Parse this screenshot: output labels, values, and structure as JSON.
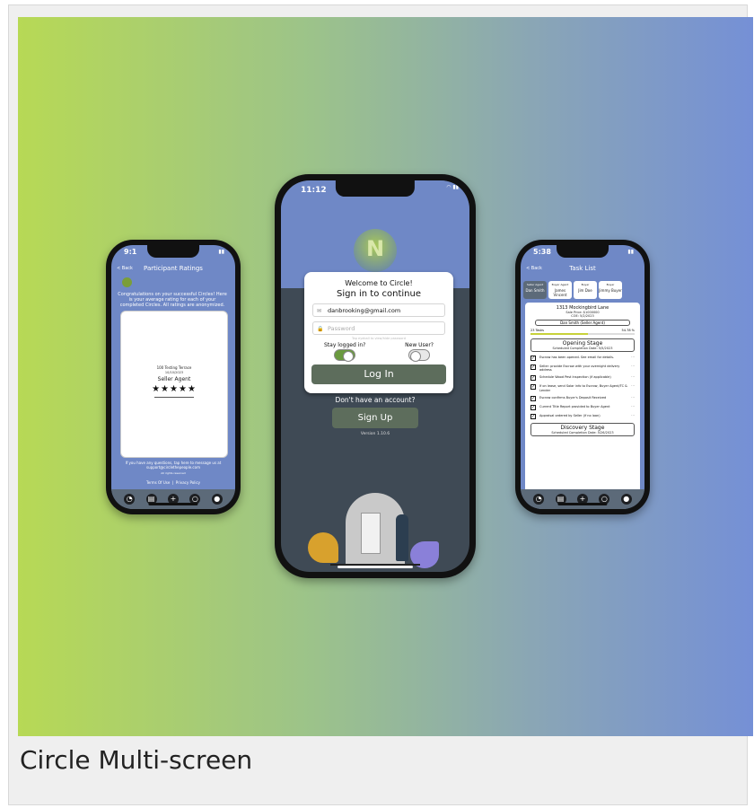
{
  "caption": "Circle Multi-screen",
  "colors": {
    "gradient_start": "#b7d955",
    "gradient_end": "#7590d6",
    "accent": "#6f88c6",
    "button": "#5d6d5c"
  },
  "left_phone": {
    "time": "9:1",
    "back": "< Back",
    "title": "Participant Ratings",
    "message": "Congratulations on your successful Circles! Here is your average rating for each of your completed Circles. All ratings are anonymized.",
    "address": "100 Testing Terrace",
    "date": "10/10/2023",
    "role": "Seller Agent",
    "stars": "★★★★★",
    "footer": "If you have any questions, tap here to message us at support@circlethepeople.com",
    "rights": "All rights reserved",
    "terms": "Terms Of Use",
    "privacy": "Privacy Policy"
  },
  "center_phone": {
    "time": "11:12",
    "welcome": "Welcome to Circle!",
    "signin": "Sign in to continue",
    "email": "danbrooking@gmail.com",
    "password_placeholder": "Password",
    "hint": "Tap eyeball to view/hide password",
    "stay_logged": "Stay logged in?",
    "new_user": "New User?",
    "login_label": "Log In",
    "no_account": "Don't have an account?",
    "signup_label": "Sign Up",
    "version": "Version 1.10.6"
  },
  "right_phone": {
    "time": "5:38",
    "back": "< Back",
    "title": "Task List",
    "agents": [
      {
        "role": "Seller Agent",
        "name": "Dan Smith"
      },
      {
        "role": "Buyer Agent",
        "name": "James Vincent"
      },
      {
        "role": "Buyer",
        "name": "Jim Doe"
      },
      {
        "role": "Buyer",
        "name": "Jimmy Buyer"
      }
    ],
    "address": "1313 Mockingbird Lane",
    "sale_price": "Sale Price: $1000000",
    "coe": "COE: 5/2/2023",
    "agent_button": "Dan Smith (Seller Agent)",
    "tasks_count": "23 Tasks",
    "percent": "54.78 %",
    "stage1": "Opening Stage",
    "stage1_date": "Scheduled Completion Date: 5/5/2023",
    "tasks": [
      "Escrow has been opened. See email for details.",
      "Seller: provide Escrow with your overnight delivery address",
      "Schedule Wood Pest Inspection (if applicable)",
      "If on lease, send Solar info to Escrow, Buyer Agent/TC & Lender",
      "Escrow confirms Buyer's Deposit Received",
      "Current Title Report provided to Buyer Agent",
      "Appraisal ordered by Seller (if no loan)"
    ],
    "stage2": "Discovery Stage",
    "stage2_date": "Scheduled Completion Date: 5/26/2023"
  }
}
